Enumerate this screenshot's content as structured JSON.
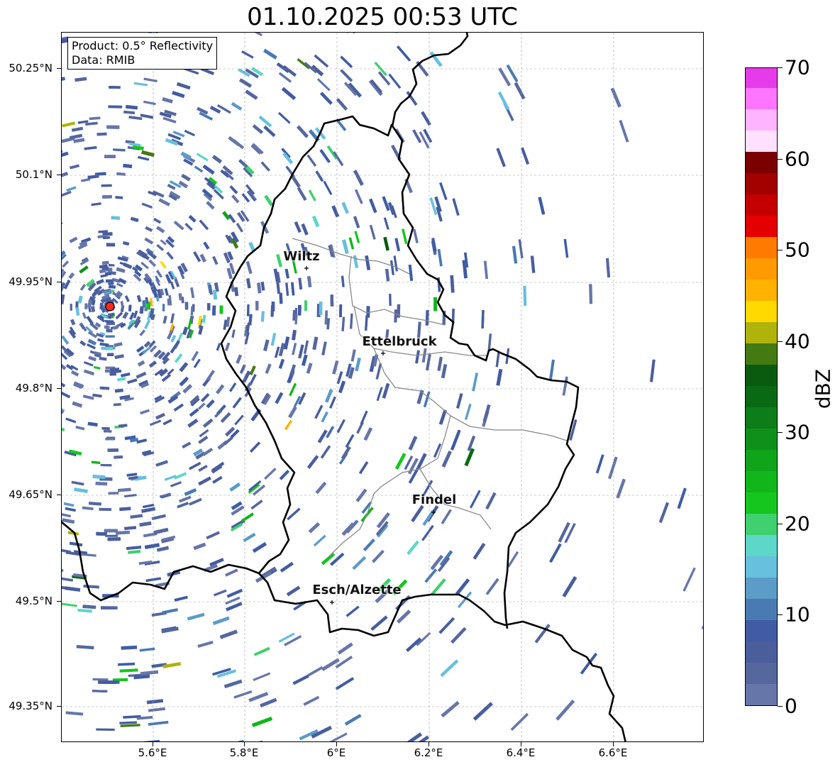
{
  "title": "01.10.2025 00:53 UTC",
  "info": {
    "product": "Product: 0.5° Reflectivity",
    "source": "Data: RMIB"
  },
  "lat_ticks": [
    "50.25°N",
    "50.1°N",
    "49.95°N",
    "49.8°N",
    "49.65°N",
    "49.5°N",
    "49.35°N"
  ],
  "lon_ticks": [
    "5.6°E",
    "5.8°E",
    "6°E",
    "6.2°E",
    "6.4°E",
    "6.6°E"
  ],
  "cities": [
    "Wiltz",
    "Ettelbruck",
    "Findel",
    "Esch/Alzette"
  ],
  "radar_site_color": "#ff2a1a",
  "colorbar": {
    "unit": "dBZ",
    "tick_labels": [
      "0",
      "10",
      "20",
      "30",
      "40",
      "50",
      "60",
      "70"
    ],
    "min": 0,
    "max": 70,
    "colors": [
      "#6776a8",
      "#56679e",
      "#4a5e9c",
      "#415ca3",
      "#4a7ab2",
      "#5b9cc8",
      "#67c0dd",
      "#5dd7c8",
      "#3fd06f",
      "#15c61f",
      "#11b61a",
      "#10a41a",
      "#0e901a",
      "#0c7d18",
      "#0a6a14",
      "#0a5a10",
      "#437a12",
      "#afb30a",
      "#ffd900",
      "#ffb200",
      "#ff9a00",
      "#ff7b00",
      "#e40000",
      "#c50000",
      "#a30000",
      "#7b0000",
      "#ffe0ff",
      "#ffb4ff",
      "#ff75ff",
      "#e63be8"
    ]
  }
}
